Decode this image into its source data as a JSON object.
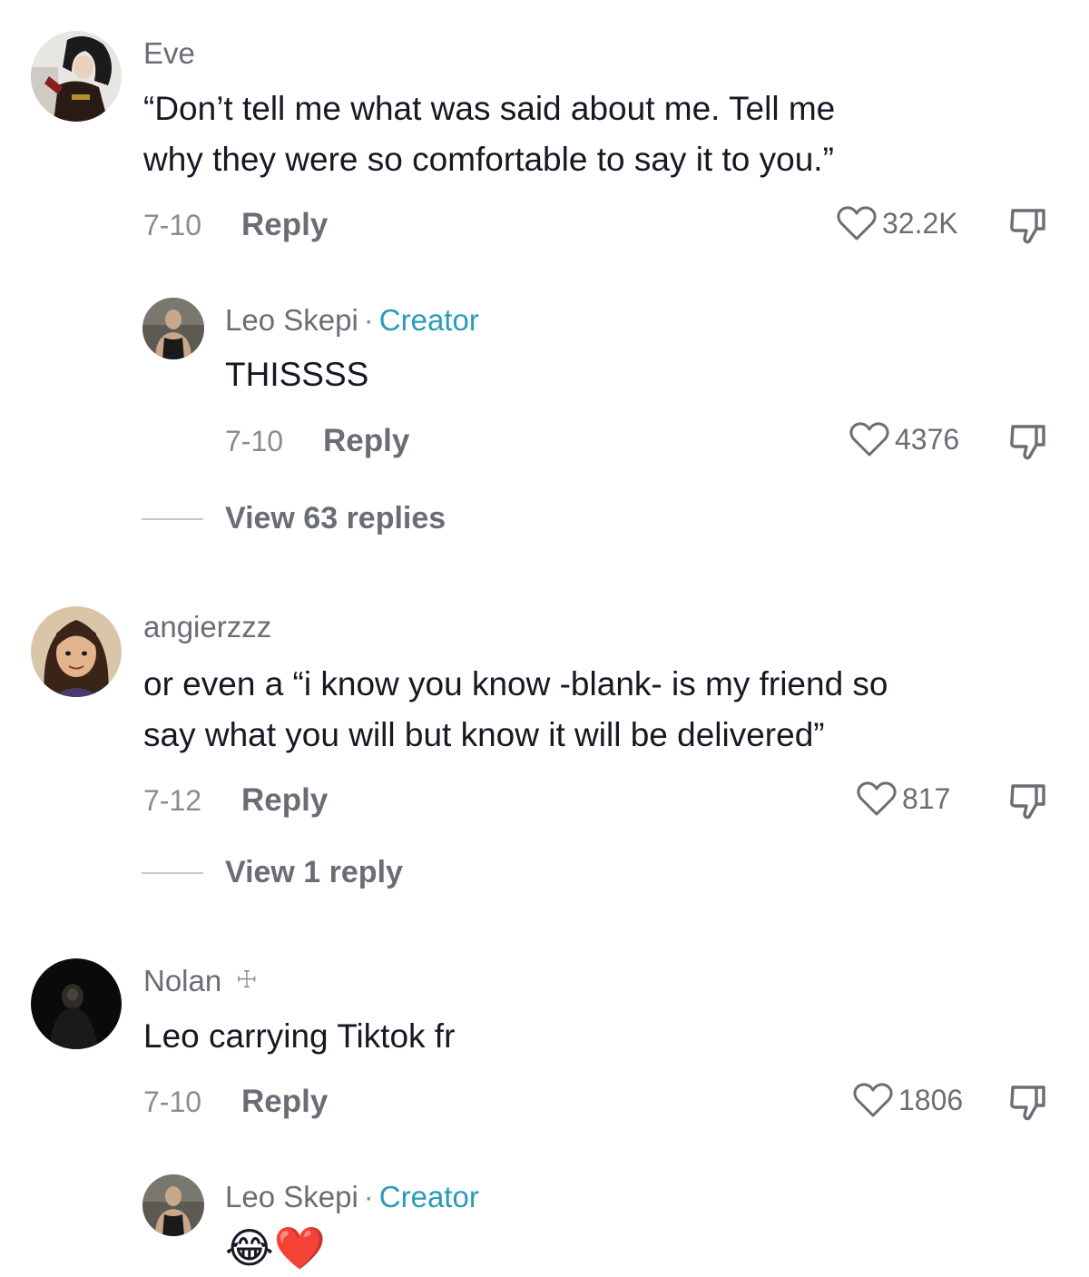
{
  "comments": [
    {
      "username": "Eve",
      "text_lines": [
        "“Don’t tell me what was said about me. Tell me",
        "why they were so comfortable to say it to you.”"
      ],
      "date": "7-10",
      "reply_label": "Reply",
      "likes": "32.2K",
      "avatar_icon": "avatar-eve-icon",
      "reply": {
        "username": "Leo Skepi",
        "separator": "·",
        "tag": "Creator",
        "text": "THISSSS",
        "date": "7-10",
        "reply_label": "Reply",
        "likes": "4376"
      },
      "view_replies": "View 63 replies"
    },
    {
      "username": "angierzzz",
      "text_lines": [
        "or even a “i know you know -blank- is my friend so",
        "say what you will but know it will be delivered”"
      ],
      "date": "7-12",
      "reply_label": "Reply",
      "likes": "817",
      "view_replies": "View 1 reply"
    },
    {
      "username": "Nolan",
      "badge": "☩",
      "text": "Leo carrying Tiktok fr",
      "date": "7-10",
      "reply_label": "Reply",
      "likes": "1806",
      "reply": {
        "username": "Leo Skepi",
        "separator": "·",
        "tag": "Creator",
        "text": "😂❤️"
      }
    }
  ],
  "colors": {
    "text": "#161823",
    "muted": "#6b6d75",
    "creator": "#2b9bb8"
  }
}
